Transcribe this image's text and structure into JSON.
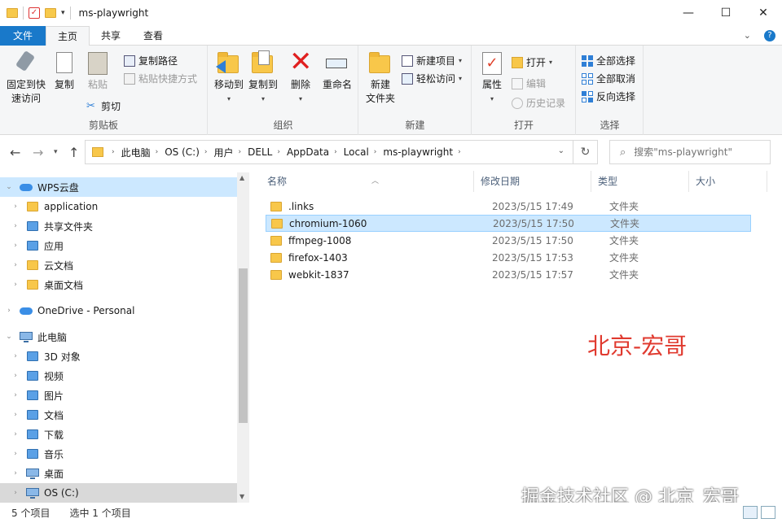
{
  "window": {
    "title": "ms-playwright",
    "minimize_glyph": "—",
    "maximize_glyph": "☐",
    "close_glyph": "✕"
  },
  "tabs": [
    "文件",
    "主页",
    "共享",
    "查看"
  ],
  "ribbon": {
    "clipboard": {
      "pin_label_1": "固定到快",
      "pin_label_2": "速访问",
      "copy": "复制",
      "paste": "粘贴",
      "copy_path": "复制路径",
      "paste_shortcut": "粘贴快捷方式",
      "cut": "剪切",
      "group_label": "剪贴板"
    },
    "organize": {
      "move_to": "移动到",
      "copy_to": "复制到",
      "delete": "删除",
      "rename": "重命名",
      "group_label": "组织"
    },
    "new": {
      "new_folder_1": "新建",
      "new_folder_2": "文件夹",
      "new_item": "新建项目",
      "easy_access": "轻松访问",
      "group_label": "新建"
    },
    "open": {
      "properties": "属性",
      "open": "打开",
      "edit": "编辑",
      "history": "历史记录",
      "group_label": "打开"
    },
    "select": {
      "select_all": "全部选择",
      "select_none": "全部取消",
      "invert": "反向选择",
      "group_label": "选择"
    }
  },
  "address": {
    "crumbs": [
      "此电脑",
      "OS (C:)",
      "用户",
      "DELL",
      "AppData",
      "Local",
      "ms-playwright"
    ],
    "search_placeholder": "搜索\"ms-playwright\""
  },
  "nav": [
    {
      "label": "WPS云盘",
      "icon": "cloud-icon",
      "level": 0,
      "expanded": true,
      "selected": true
    },
    {
      "label": "application",
      "icon": "folder-icon",
      "level": 1
    },
    {
      "label": "共享文件夹",
      "icon": "shared-folder-icon",
      "level": 1
    },
    {
      "label": "应用",
      "icon": "apps-icon",
      "level": 1
    },
    {
      "label": "云文档",
      "icon": "folder-icon",
      "level": 1
    },
    {
      "label": "桌面文档",
      "icon": "folder-icon",
      "level": 1
    },
    {
      "label": "OneDrive - Personal",
      "icon": "onedrive-icon",
      "level": 0
    },
    {
      "label": "此电脑",
      "icon": "computer-icon",
      "level": 0,
      "expanded": true
    },
    {
      "label": "3D 对象",
      "icon": "3d-objects-icon",
      "level": 1
    },
    {
      "label": "视频",
      "icon": "video-icon",
      "level": 1
    },
    {
      "label": "图片",
      "icon": "pictures-icon",
      "level": 1
    },
    {
      "label": "文档",
      "icon": "documents-icon",
      "level": 1
    },
    {
      "label": "下载",
      "icon": "download-icon",
      "level": 1
    },
    {
      "label": "音乐",
      "icon": "music-icon",
      "level": 1
    },
    {
      "label": "桌面",
      "icon": "desktop-icon",
      "level": 1
    },
    {
      "label": "OS (C:)",
      "icon": "drive-icon",
      "level": 1,
      "highlighted": true
    }
  ],
  "columns": {
    "name": "名称",
    "date": "修改日期",
    "type": "类型",
    "size": "大小"
  },
  "files": [
    {
      "name": ".links",
      "date": "2023/5/15 17:49",
      "type": "文件夹"
    },
    {
      "name": "chromium-1060",
      "date": "2023/5/15 17:50",
      "type": "文件夹",
      "selected": true
    },
    {
      "name": "ffmpeg-1008",
      "date": "2023/5/15 17:50",
      "type": "文件夹"
    },
    {
      "name": "firefox-1403",
      "date": "2023/5/15 17:53",
      "type": "文件夹"
    },
    {
      "name": "webkit-1837",
      "date": "2023/5/15 17:57",
      "type": "文件夹"
    }
  ],
  "watermarks": {
    "red": "北京-宏哥",
    "bottom": "掘金技术社区 @ 北京_宏哥"
  },
  "status": {
    "count": "5 个项目",
    "selected": "选中 1 个项目"
  },
  "colors": {
    "accent": "#1979ca",
    "selection": "#cce8ff",
    "folder": "#f8c74a",
    "watermark_red": "#e03a2f"
  }
}
